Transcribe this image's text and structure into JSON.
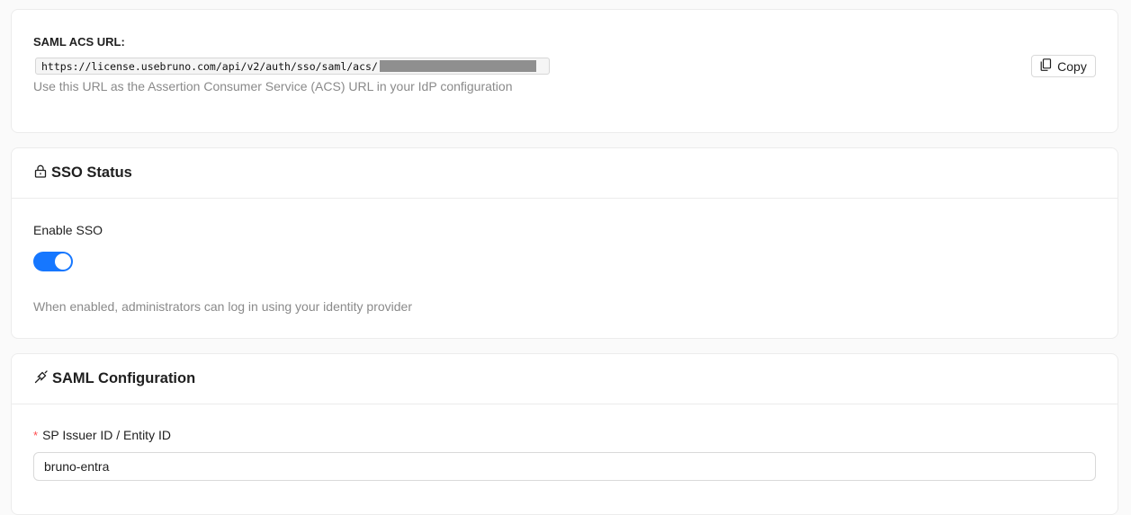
{
  "acs": {
    "label": "SAML ACS URL:",
    "url": "https://license.usebruno.com/api/v2/auth/sso/saml/acs/",
    "helper": "Use this URL as the Assertion Consumer Service (ACS) URL in your IdP configuration",
    "copy_label": "Copy"
  },
  "sso_status": {
    "title": "SSO Status",
    "icon": "lock-icon",
    "enable_label": "Enable SSO",
    "enabled": true,
    "helper": "When enabled, administrators can log in using your identity provider"
  },
  "saml_config": {
    "title": "SAML Configuration",
    "icon": "plug-icon",
    "sp_issuer": {
      "required_mark": "*",
      "label": "SP Issuer ID / Entity ID",
      "value": "bruno-entra"
    }
  },
  "colors": {
    "accent": "#1677ff",
    "required": "#ff4d4f",
    "muted_text": "#8a8a8a"
  }
}
